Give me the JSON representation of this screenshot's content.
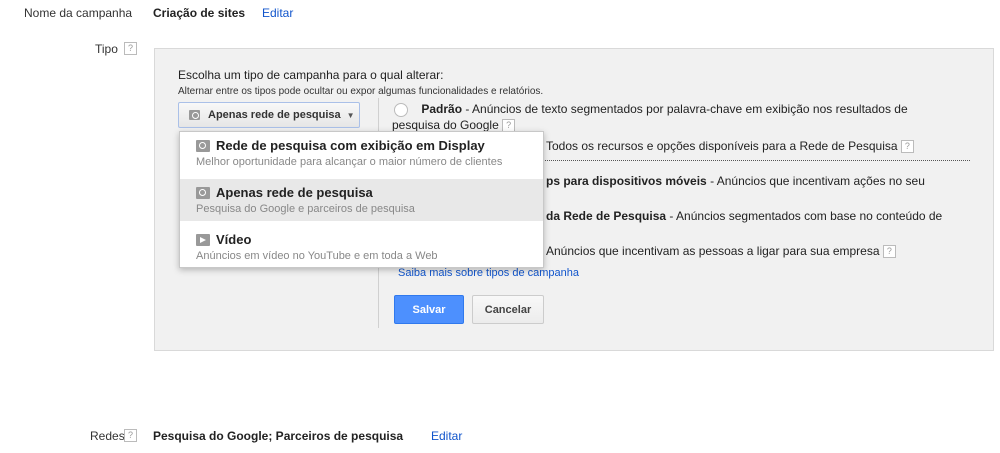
{
  "campaign": {
    "label": "Nome da campanha",
    "value": "Criação de sites",
    "edit": "Editar"
  },
  "type": {
    "label": "Tipo",
    "help": "?"
  },
  "panel": {
    "heading": "Escolha um tipo de campanha para o qual alterar:",
    "subheading": "Alternar entre os tipos pode ocultar ou expor algumas funcionalidades e relatórios.",
    "dropdown_label": "Apenas rede de pesquisa",
    "options": [
      {
        "title": "Padrão",
        "desc": " - Anúncios de texto segmentados por palavra-chave em exibição nos resultados de",
        "desc2": "pesquisa do Google"
      },
      {
        "title": "",
        "desc": "Todos os recursos e opções disponíveis para a Rede de Pesquisa"
      },
      {
        "title": "ps para dispositivos móveis",
        "desc": " - Anúncios que incentivam ações no seu"
      },
      {
        "title": "da Rede de Pesquisa",
        "desc": " - Anúncios segmentados com base no conteúdo de"
      },
      {
        "title": "",
        "desc": "Anúncios que incentivam as pessoas a ligar para sua empresa"
      }
    ],
    "learn_more": "Saiba mais sobre tipos de campanha",
    "save": "Salvar",
    "cancel": "Cancelar"
  },
  "menu": [
    {
      "title": "Rede de pesquisa com exibição em Display",
      "desc": "Melhor oportunidade para alcançar o maior número de clientes",
      "icon": "search-display-icon"
    },
    {
      "title": "Apenas rede de pesquisa",
      "desc": "Pesquisa do Google e parceiros de pesquisa",
      "icon": "search-icon"
    },
    {
      "title": "Vídeo",
      "desc": "Anúncios em vídeo no YouTube e em toda a Web",
      "icon": "video-icon"
    }
  ],
  "networks": {
    "label": "Redes",
    "value": "Pesquisa do Google; Parceiros de pesquisa",
    "edit": "Editar",
    "help": "?"
  }
}
